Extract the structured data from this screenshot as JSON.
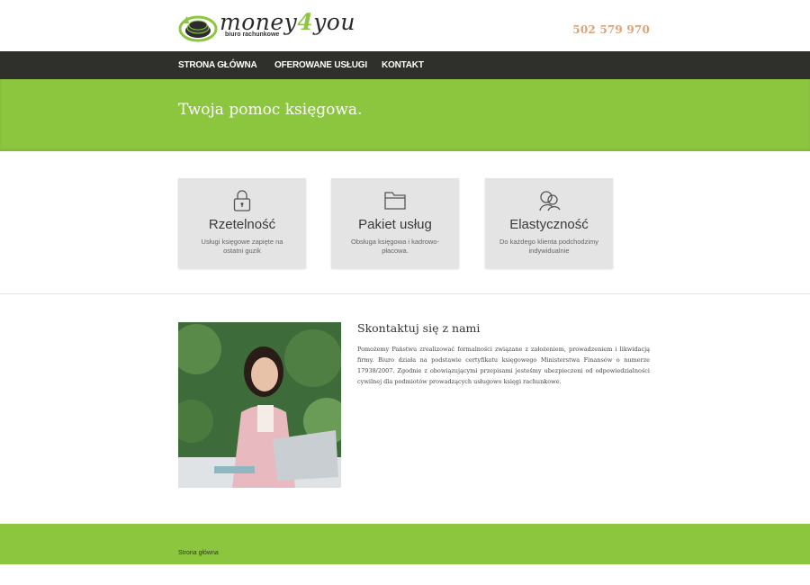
{
  "header": {
    "logo_text_a": "money",
    "logo_text_b": "4",
    "logo_text_c": "you",
    "logo_subtitle": "biuro rachunkowe",
    "phone": "502 579 970"
  },
  "nav": {
    "items": [
      {
        "label": "STRONA GŁÓWNA"
      },
      {
        "label": "OFEROWANE USŁUGI"
      },
      {
        "label": "KONTAKT"
      }
    ]
  },
  "hero": {
    "title": "Twoja pomoc księgowa."
  },
  "cards": [
    {
      "icon": "lock-icon",
      "title": "Rzetelność",
      "desc": "Usługi księgowe zapięte na ostatni guzik"
    },
    {
      "icon": "folder-icon",
      "title": "Pakiet usług",
      "desc": "Obsługa księgowa i kadrowo-płacowa."
    },
    {
      "icon": "users-icon",
      "title": "Elastyczność",
      "desc": "Do każdego klienta podchodzimy indywidualnie"
    }
  ],
  "contact": {
    "title": "Skontaktuj się z nami",
    "text": "Pomożemy Państwu zrealizować formalności związane z założeniem, prowadzeniem i likwidacją firmy. Biuro działa na podstawie certyfikatu księgowego Ministerstwa Finansów o numerze 17938/2007. Zgodnie z obowiązującymi przepisami jesteśmy ubezpieczeni od odpowiedzialności cywilnej dla podmiotów prowadzących usługowo księgi rachunkowe."
  },
  "footer": {
    "link": "Strona główna"
  },
  "colors": {
    "accent_green": "#8cc63f",
    "nav_dark": "#2f302b",
    "phone": "#d9a27a",
    "card_bg": "#e4e4e4"
  }
}
